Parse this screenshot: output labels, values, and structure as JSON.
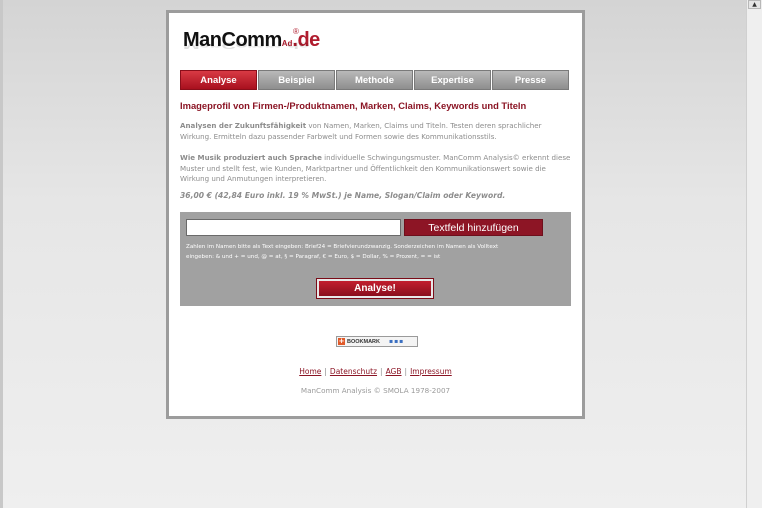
{
  "logo": {
    "brand_main": "ManComm",
    "brand_small": "Ad",
    "brand_tld": ".de",
    "registered": "®"
  },
  "nav": {
    "tabs": [
      {
        "label": "Analyse",
        "active": true
      },
      {
        "label": "Beispiel",
        "active": false
      },
      {
        "label": "Methode",
        "active": false
      },
      {
        "label": "Expertise",
        "active": false
      },
      {
        "label": "Presse",
        "active": false
      }
    ]
  },
  "content": {
    "heading": "Imageprofil von Firmen-/Produktnamen, Marken, Claims, Keywords und Titeln",
    "p1_bold": "Analysen der Zukunftsfähigkeit",
    "p1_rest": " von Namen, Marken, Claims und Titeln. Testen deren sprachlicher Wirkung. Ermitteln dazu passender Farbwelt und Formen sowie des Kommunikationsstils.",
    "p2_bold": "Wie Musik produziert auch Sprache",
    "p2_rest": " individuelle Schwingungsmuster. ManComm Analysis© erkennt diese Muster und stellt fest, wie Kunden, Marktpartner und Öffentlichkeit den Kommunikationswert sowie die Wirkung und Anmutungen interpretieren.",
    "price": "36,00 € (42,84 Euro inkl. 19 % MwSt.) je Name, Slogan/Claim oder Keyword."
  },
  "form": {
    "text_value": "",
    "add_button": "Textfeld hinzufügen",
    "hint_line1": "Zahlen im Namen bitte als Text eingeben: Brief24 = Briefvierundzwanzig. Sonderzeichen im Namen als Volltext",
    "hint_line2": "eingeben: & und + = und, @ = at, § = Paragraf, € = Euro, $ = Dollar, % = Prozent, = = ist",
    "submit_button": "Analyse!"
  },
  "bookmark": {
    "label": "BOOKMARK",
    "icons": "▪▪▪"
  },
  "footer": {
    "links": [
      "Home",
      "Datenschutz",
      "AGB",
      "Impressum"
    ],
    "separator": "|",
    "copyright": "ManComm Analysis © SMOLA 1978-2007"
  },
  "colors": {
    "accent": "#8b1424",
    "tab_grey": "#9e9e9e",
    "form_bg": "#a1a1a1"
  }
}
